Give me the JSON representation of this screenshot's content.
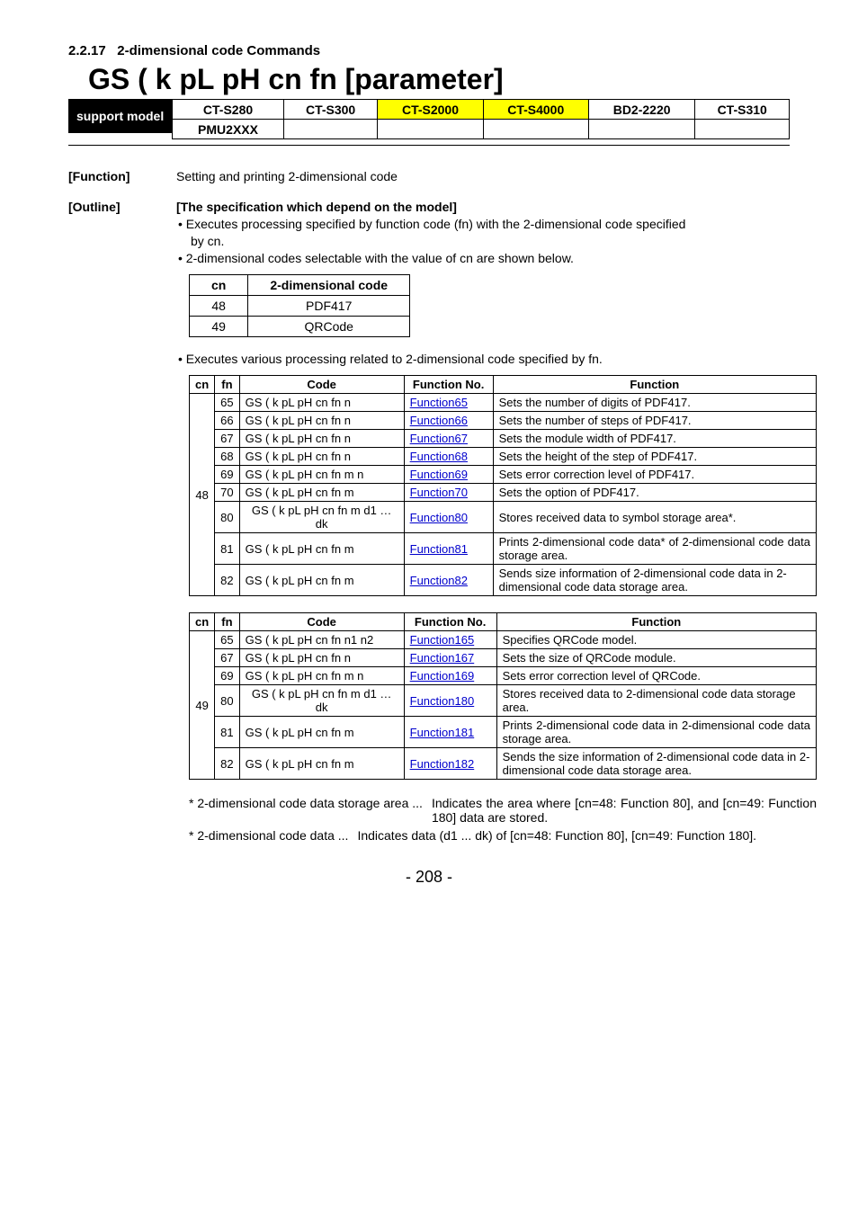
{
  "section_num": "2.2.17",
  "section_title": "2-dimensional code Commands",
  "heading": "GS ( k pL pH cn fn [parameter]",
  "support_label": "support model",
  "support_models_row1": [
    "CT-S280",
    "CT-S300",
    "CT-S2000",
    "CT-S4000",
    "BD2-2220",
    "CT-S310"
  ],
  "support_models_row2": [
    "PMU2XXX",
    "",
    "",
    "",
    "",
    ""
  ],
  "function_key": "[Function]",
  "function_val": "Setting and printing 2-dimensional code",
  "outline_key": "[Outline]",
  "outline_title": "[The specification which depend on the model]",
  "outline_b1": "• Executes processing specified by function code (fn) with the 2-dimensional code specified",
  "outline_b1b": "by cn.",
  "outline_b2": "• 2-dimensional codes selectable with the value of cn are shown below.",
  "cn_header": {
    "c1": "cn",
    "c2": "2-dimensional code"
  },
  "cn_rows": [
    {
      "c": "48",
      "d": "PDF417"
    },
    {
      "c": "49",
      "d": "QRCode"
    }
  ],
  "outline_b3": "• Executes various processing related to 2-dimensional code specified by fn.",
  "tbl_header": {
    "cn": "cn",
    "fn": "fn",
    "code": "Code",
    "fno": "Function No.",
    "func": "Function"
  },
  "tbl48_cn": "48",
  "tbl48": [
    {
      "fn": "65",
      "code": "GS ( k pL pH cn fn n",
      "fno": "Function65",
      "func": "Sets the number of digits of PDF417."
    },
    {
      "fn": "66",
      "code": "GS ( k pL pH cn fn n",
      "fno": "Function66",
      "func": "Sets the number of steps of PDF417."
    },
    {
      "fn": "67",
      "code": "GS ( k pL pH cn fn n",
      "fno": "Function67",
      "func": "Sets the module width of PDF417."
    },
    {
      "fn": "68",
      "code": "GS ( k pL pH cn fn n",
      "fno": "Function68",
      "func": "Sets the height of the step of PDF417."
    },
    {
      "fn": "69",
      "code": "GS ( k pL pH cn fn m n",
      "fno": "Function69",
      "func": "Sets error correction level of PDF417."
    },
    {
      "fn": "70",
      "code": "GS ( k pL pH cn fn m",
      "fno": "Function70",
      "func": "Sets the option of PDF417."
    },
    {
      "fn": "80",
      "code": "GS ( k pL pH cn fn m d1 … dk",
      "fno": "Function80",
      "func": "Stores received data to symbol storage area*."
    },
    {
      "fn": "81",
      "code": "GS ( k pL pH cn fn m",
      "fno": "Function81",
      "func": "Prints 2-dimensional code data* of 2-dimensional code data storage area."
    },
    {
      "fn": "82",
      "code": "GS ( k pL pH cn fn m",
      "fno": "Function82",
      "func": "Sends size information of 2-dimensional code data in 2-dimensional code data storage area."
    }
  ],
  "tbl49_cn": "49",
  "tbl49": [
    {
      "fn": "65",
      "code": "GS ( k pL pH cn fn n1 n2",
      "fno": "Function165",
      "func": "Specifies QRCode model."
    },
    {
      "fn": "67",
      "code": "GS ( k pL pH cn fn n",
      "fno": "Function167",
      "func": "Sets the size of QRCode module."
    },
    {
      "fn": "69",
      "code": "GS ( k pL pH cn fn m n",
      "fno": "Function169",
      "func": "Sets error correction level of QRCode."
    },
    {
      "fn": "80",
      "code": "GS ( k pL pH cn fn m d1 … dk",
      "fno": "Function180",
      "func": "Stores received data to 2-dimensional code data storage area."
    },
    {
      "fn": "81",
      "code": "GS ( k pL pH cn fn m",
      "fno": "Function181",
      "func": "Prints 2-dimensional code data in 2-dimensional code data storage area."
    },
    {
      "fn": "82",
      "code": "GS ( k pL pH cn fn m",
      "fno": "Function182",
      "func": "Sends the size information of 2-dimensional code data in 2-dimensional code data storage area."
    }
  ],
  "foot1a": "* 2-dimensional code data storage area ...",
  "foot1b": "Indicates the area where [cn=48: Function 80], and [cn=49: Function 180] data are stored.",
  "foot2a": "* 2-dimensional code data ...",
  "foot2b": "Indicates data (d1 ... dk) of [cn=48: Function 80], [cn=49: Function 180].",
  "pagenum": "- 208 -",
  "chart_data": {
    "type": "table",
    "title": "2-dimensional code Commands function table",
    "tables": [
      {
        "cn": 48,
        "rows": [
          [
            65,
            "Function65"
          ],
          [
            66,
            "Function66"
          ],
          [
            67,
            "Function67"
          ],
          [
            68,
            "Function68"
          ],
          [
            69,
            "Function69"
          ],
          [
            70,
            "Function70"
          ],
          [
            80,
            "Function80"
          ],
          [
            81,
            "Function81"
          ],
          [
            82,
            "Function82"
          ]
        ]
      },
      {
        "cn": 49,
        "rows": [
          [
            65,
            "Function165"
          ],
          [
            67,
            "Function167"
          ],
          [
            69,
            "Function169"
          ],
          [
            80,
            "Function180"
          ],
          [
            81,
            "Function181"
          ],
          [
            82,
            "Function182"
          ]
        ]
      }
    ]
  }
}
